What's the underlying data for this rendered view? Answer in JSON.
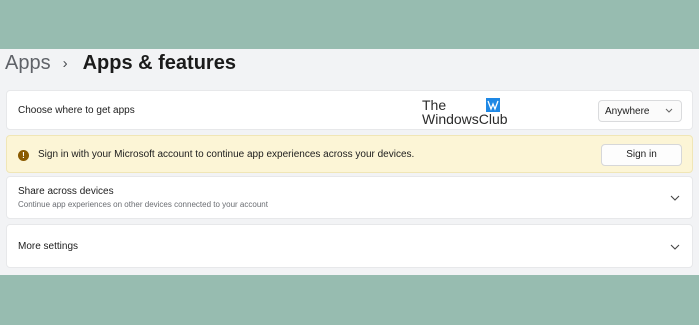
{
  "breadcrumb": {
    "parent": "Apps",
    "separator": "›",
    "title": "Apps & features"
  },
  "choose_where": {
    "label": "Choose where to get apps",
    "selected": "Anywhere"
  },
  "watermark": {
    "line1": "The",
    "line2": "WindowsClub"
  },
  "warning": {
    "icon": "!",
    "message": "Sign in with your Microsoft account to continue app experiences across your devices.",
    "button": "Sign in"
  },
  "share_across": {
    "title": "Share across devices",
    "description": "Continue app experiences on other devices connected to your account"
  },
  "more_settings": {
    "title": "More settings"
  },
  "colors": {
    "backdrop": "#97bcb0",
    "panel": "#f2f3f5",
    "card": "#ffffff",
    "warning_bg": "#fcf5d6",
    "warning_icon": "#8a5a00",
    "logo_blue": "#1e88e5"
  }
}
